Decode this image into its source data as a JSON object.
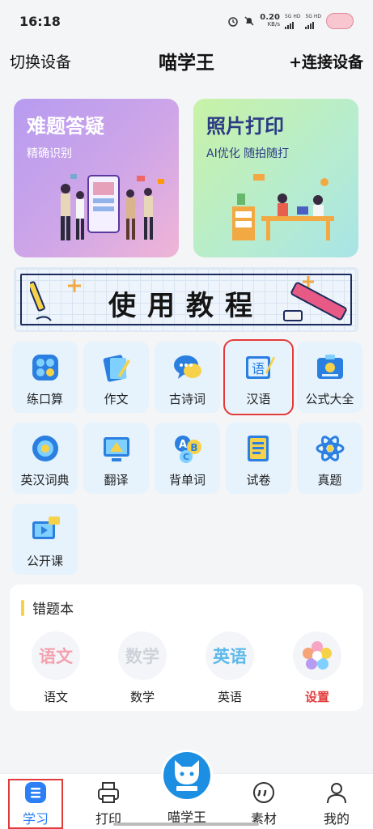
{
  "status": {
    "time": "16:18",
    "net_speed_top": "0.20",
    "net_speed_unit": "KB/s",
    "sig1": "5G HD",
    "sig2": "5G HD"
  },
  "header": {
    "left": "切换设备",
    "title": "喵学王",
    "right": "+连接设备"
  },
  "cards": [
    {
      "title": "难题答疑",
      "subtitle": "精确识别"
    },
    {
      "title": "照片打印",
      "subtitle": "AI优化 随拍随打"
    }
  ],
  "banner": {
    "text": "使用教程"
  },
  "tiles": [
    {
      "label": "练口算",
      "icon": "calculator-icon"
    },
    {
      "label": "作文",
      "icon": "writing-icon"
    },
    {
      "label": "古诗词",
      "icon": "chat-bubble-icon"
    },
    {
      "label": "汉语",
      "icon": "chinese-language-icon"
    },
    {
      "label": "公式大全",
      "icon": "formula-card-icon"
    },
    {
      "label": "英汉词典",
      "icon": "dictionary-icon"
    },
    {
      "label": "翻译",
      "icon": "translate-board-icon"
    },
    {
      "label": "背单词",
      "icon": "abc-icon"
    },
    {
      "label": "试卷",
      "icon": "exam-paper-icon"
    },
    {
      "label": "真题",
      "icon": "atom-icon"
    },
    {
      "label": "公开课",
      "icon": "video-lesson-icon"
    }
  ],
  "wrongbook": {
    "title": "错题本",
    "subjects": [
      {
        "circle": "语文",
        "label": "语文",
        "color": "#f4a0ad"
      },
      {
        "circle": "数学",
        "label": "数学",
        "color": "#d6d8de"
      },
      {
        "circle": "英语",
        "label": "英语",
        "color": "#5bb8ea"
      },
      {
        "circle": "",
        "label": "设置",
        "color": "#e23b3b"
      }
    ]
  },
  "nav": {
    "items": [
      "学习",
      "打印",
      "喵学王",
      "素材",
      "我的"
    ],
    "active": "学习"
  },
  "colors": {
    "accent": "#2c7ff5",
    "highlight": "#e23b3b",
    "tile_bg": "#e6f3fd"
  }
}
